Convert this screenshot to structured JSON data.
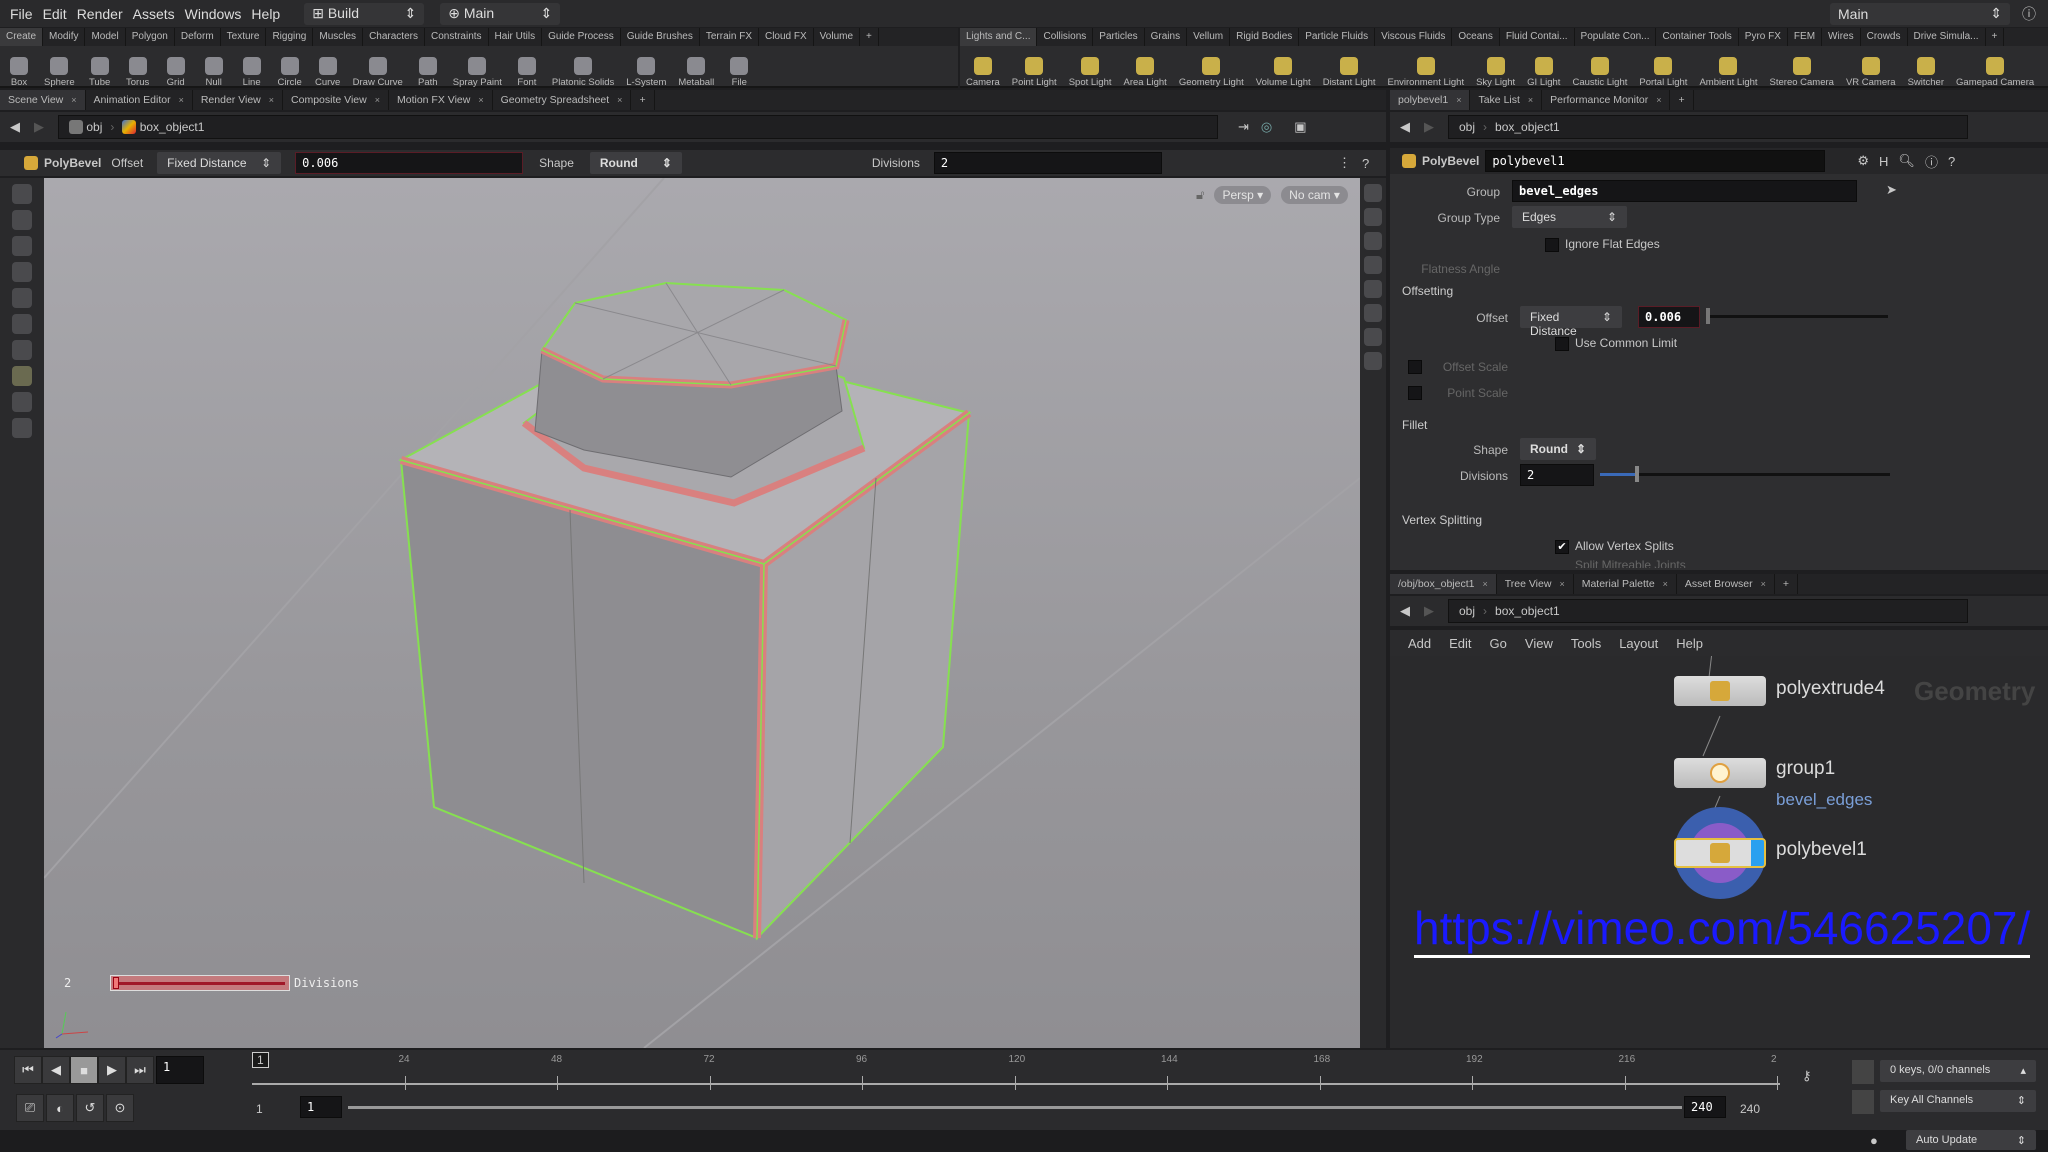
{
  "menubar": {
    "items": [
      "File",
      "Edit",
      "Render",
      "Assets",
      "Windows",
      "Help"
    ],
    "desktop": "Build",
    "context": "Main",
    "right_context": "Main"
  },
  "shelf_left": {
    "tabs": [
      "Create",
      "Modify",
      "Model",
      "Polygon",
      "Deform",
      "Texture",
      "Rigging",
      "Muscles",
      "Characters",
      "Constraints",
      "Hair Utils",
      "Guide Process",
      "Guide Brushes",
      "Terrain FX",
      "Cloud FX",
      "Volume"
    ],
    "tools": [
      "Box",
      "Sphere",
      "Tube",
      "Torus",
      "Grid",
      "Null",
      "Line",
      "Circle",
      "Curve",
      "Draw Curve",
      "Path",
      "Spray Paint",
      "Font",
      "Platonic Solids",
      "L-System",
      "Metaball",
      "File"
    ]
  },
  "shelf_right": {
    "tabs": [
      "Lights and C...",
      "Collisions",
      "Particles",
      "Grains",
      "Vellum",
      "Rigid Bodies",
      "Particle Fluids",
      "Viscous Fluids",
      "Oceans",
      "Fluid Contai...",
      "Populate Con...",
      "Container Tools",
      "Pyro FX",
      "FEM",
      "Wires",
      "Crowds",
      "Drive Simula..."
    ],
    "tools": [
      "Camera",
      "Point Light",
      "Spot Light",
      "Area Light",
      "Geometry Light",
      "Volume Light",
      "Distant Light",
      "Environment Light",
      "Sky Light",
      "GI Light",
      "Caustic Light",
      "Portal Light",
      "Ambient Light",
      "Stereo Camera",
      "VR Camera",
      "Switcher",
      "Gamepad Camera"
    ]
  },
  "left_pane": {
    "tabs": [
      "Scene View",
      "Animation Editor",
      "Render View",
      "Composite View",
      "Motion FX View",
      "Geometry Spreadsheet"
    ],
    "path": {
      "root": "obj",
      "node": "box_object1"
    },
    "operator": {
      "name": "PolyBevel",
      "offset_label": "Offset",
      "offset_mode": "Fixed Distance",
      "offset_value": "0.006",
      "shape_label": "Shape",
      "shape_value": "Round",
      "divisions_label": "Divisions",
      "divisions_value": "2"
    },
    "viewport": {
      "camera": "Persp",
      "cam_menu": "No cam",
      "handle_value": "2",
      "handle_label": "Divisions",
      "handle_fraction": 0.0,
      "axes": [
        "x",
        "y",
        "z"
      ]
    }
  },
  "param_pane": {
    "tabs": [
      "polybevel1",
      "Take List",
      "Performance Monitor"
    ],
    "path": {
      "root": "obj",
      "node": "box_object1"
    },
    "node_type": "PolyBevel",
    "node_name": "polybevel1",
    "group_label": "Group",
    "group_value": "bevel_edges",
    "group_type_label": "Group Type",
    "group_type_value": "Edges",
    "ignore_flat": "Ignore Flat Edges",
    "flatness_label": "Flatness Angle",
    "offsetting": "Offsetting",
    "offset_label": "Offset",
    "offset_mode": "Fixed Distance",
    "offset_value": "0.006",
    "common_limit": "Use Common Limit",
    "offset_scale": "Offset Scale",
    "point_scale": "Point Scale",
    "fillet": "Fillet",
    "shape_label": "Shape",
    "shape_value": "Round",
    "divisions_label": "Divisions",
    "divisions_value": "2",
    "divisions_fraction": 0.12,
    "vertex_splitting": "Vertex Splitting",
    "allow_splits": "Allow Vertex Splits",
    "split_joints": "Split Mitreable Joints"
  },
  "network_pane": {
    "tabs": [
      "/obj/box_object1",
      "Tree View",
      "Material Palette",
      "Asset Browser"
    ],
    "path": {
      "root": "obj",
      "node": "box_object1"
    },
    "menu": [
      "Add",
      "Edit",
      "Go",
      "View",
      "Tools",
      "Layout",
      "Help"
    ],
    "context_label": "Geometry",
    "nodes": [
      {
        "name": "polyextrude4"
      },
      {
        "name": "group1",
        "sub": "bevel_edges"
      },
      {
        "name": "polybevel1"
      }
    ]
  },
  "overlay_url": "https://vimeo.com/546625207/",
  "timeline": {
    "ticks": [
      "24",
      "48",
      "72",
      "96",
      "120",
      "144",
      "168",
      "192",
      "216",
      "2"
    ],
    "current_frame": "1",
    "frame_field": "1",
    "range_start": "1",
    "range_start2": "1",
    "range_end": "240",
    "range_end2": "240",
    "keys_info": "0 keys, 0/0 channels",
    "key_mode": "Key All Channels",
    "update_mode": "Auto Update"
  }
}
